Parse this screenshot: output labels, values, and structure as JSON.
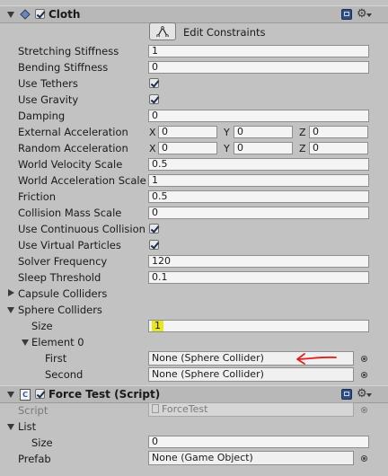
{
  "cloth": {
    "title": "Cloth",
    "enabled": true,
    "edit_constraints_label": "Edit Constraints",
    "properties": [
      {
        "label": "Stretching Stiffness",
        "value": "1"
      },
      {
        "label": "Bending Stiffness",
        "value": "0"
      }
    ],
    "use_tethers": {
      "label": "Use Tethers",
      "checked": true
    },
    "use_gravity": {
      "label": "Use Gravity",
      "checked": true
    },
    "damping": {
      "label": "Damping",
      "value": "0"
    },
    "external_acceleration": {
      "label": "External Acceleration",
      "x": "0",
      "y": "0",
      "z": "0"
    },
    "random_acceleration": {
      "label": "Random Acceleration",
      "x": "0",
      "y": "0",
      "z": "0"
    },
    "world_velocity_scale": {
      "label": "World Velocity Scale",
      "value": "0.5"
    },
    "world_acceleration_scale": {
      "label": "World Acceleration Scale",
      "value": "1"
    },
    "friction": {
      "label": "Friction",
      "value": "0.5"
    },
    "collision_mass_scale": {
      "label": "Collision Mass Scale",
      "value": "0"
    },
    "use_continuous_collision": {
      "label": "Use Continuous Collision",
      "checked": true
    },
    "use_virtual_particles": {
      "label": "Use Virtual Particles",
      "checked": true
    },
    "solver_frequency": {
      "label": "Solver Frequency",
      "value": "120"
    },
    "sleep_threshold": {
      "label": "Sleep Threshold",
      "value": "0.1"
    },
    "capsule_colliders": {
      "label": "Capsule Colliders"
    },
    "sphere_colliders": {
      "label": "Sphere Colliders",
      "size_label": "Size",
      "size_value": "1",
      "element_label": "Element 0",
      "first_label": "First",
      "first_value": "None (Sphere Collider)",
      "second_label": "Second",
      "second_value": "None (Sphere Collider)"
    },
    "axis_labels": {
      "x": "X",
      "y": "Y",
      "z": "Z"
    }
  },
  "force_test": {
    "title": "Force Test (Script)",
    "enabled": true,
    "script_label": "Script",
    "script_value": "ForceTest",
    "list_label": "List",
    "size_label": "Size",
    "size_value": "0",
    "prefab_label": "Prefab",
    "prefab_value": "None (Game Object)"
  },
  "colors": {
    "highlight": "#e8e620",
    "arrow": "#e0201c",
    "book_icon": "#2f4e83"
  }
}
